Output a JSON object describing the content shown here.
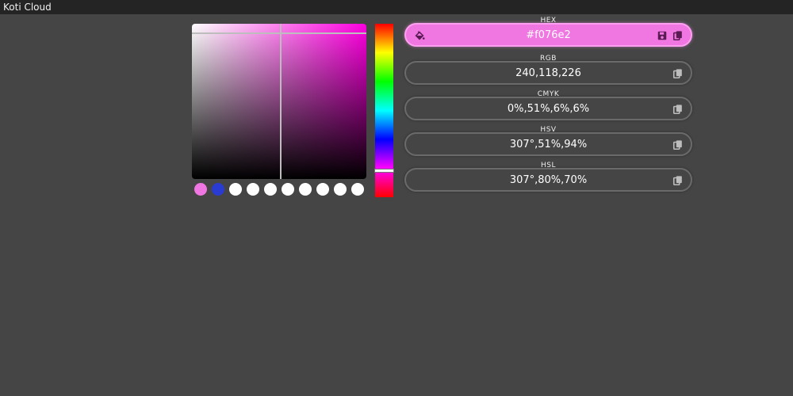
{
  "app": {
    "title": "Koti Cloud"
  },
  "picker": {
    "hue_position": 0.847,
    "saturation": 0.51,
    "value": 0.94,
    "swatches": [
      {
        "color": "#f076e2"
      },
      {
        "color": "#2a3bd1"
      },
      {
        "color": "#ffffff"
      },
      {
        "color": "#ffffff"
      },
      {
        "color": "#ffffff"
      },
      {
        "color": "#ffffff"
      },
      {
        "color": "#ffffff"
      },
      {
        "color": "#ffffff"
      },
      {
        "color": "#ffffff"
      },
      {
        "color": "#ffffff"
      }
    ]
  },
  "fields": {
    "hex": {
      "label": "HEX",
      "value": "#f076e2"
    },
    "rgb": {
      "label": "RGB",
      "value": "240,118,226"
    },
    "cmyk": {
      "label": "CMYK",
      "value": "0%,51%,6%,6%"
    },
    "hsv": {
      "label": "HSV",
      "value": "307°,51%,94%"
    },
    "hsl": {
      "label": "HSL",
      "value": "307°,80%,70%"
    }
  },
  "colors": {
    "current": "#f076e2",
    "history_second": "#2a3bd1",
    "background": "#454545",
    "titlebar": "#242424"
  },
  "icons": {
    "fill": "paint-bucket-icon",
    "save": "save-icon",
    "copy": "copy-icon"
  }
}
